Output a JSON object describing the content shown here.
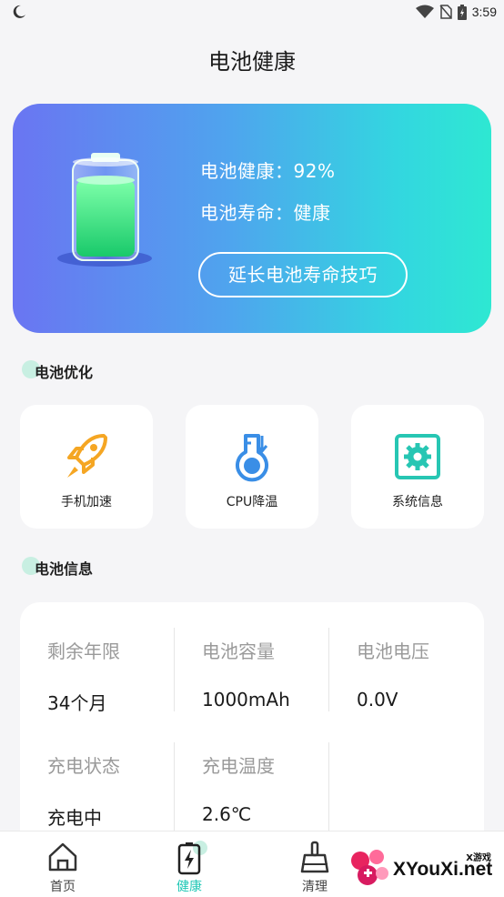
{
  "status_bar": {
    "time": "3:59"
  },
  "header": {
    "title": "电池健康"
  },
  "hero": {
    "health_line": "电池健康：92%",
    "life_line": "电池寿命：健康",
    "tips_button": "延长电池寿命技巧"
  },
  "optimize": {
    "title": "电池优化",
    "tools": [
      {
        "label": "手机加速",
        "icon": "rocket-icon"
      },
      {
        "label": "CPU降温",
        "icon": "thermometer-icon"
      },
      {
        "label": "系统信息",
        "icon": "settings-icon"
      }
    ]
  },
  "info": {
    "title": "电池信息",
    "cells": [
      {
        "label": "剩余年限",
        "value": "34个月"
      },
      {
        "label": "电池容量",
        "value": "1000mAh"
      },
      {
        "label": "电池电压",
        "value": "0.0V"
      },
      {
        "label": "充电状态",
        "value": "充电中"
      },
      {
        "label": "充电温度",
        "value": "2.6℃"
      }
    ]
  },
  "nav": {
    "items": [
      {
        "label": "首页",
        "icon": "home-icon"
      },
      {
        "label": "健康",
        "icon": "battery-icon",
        "active": true
      },
      {
        "label": "清理",
        "icon": "broom-icon"
      }
    ]
  },
  "watermark": {
    "small": "X游戏",
    "big": "XYouXi.net"
  },
  "colors": {
    "accent": "#1fc7b5",
    "hero_start": "#6a75f2",
    "hero_end": "#2ee8d2",
    "tool_orange": "#f5a623",
    "tool_blue": "#3a8ee6",
    "tool_teal": "#27c6b3"
  }
}
